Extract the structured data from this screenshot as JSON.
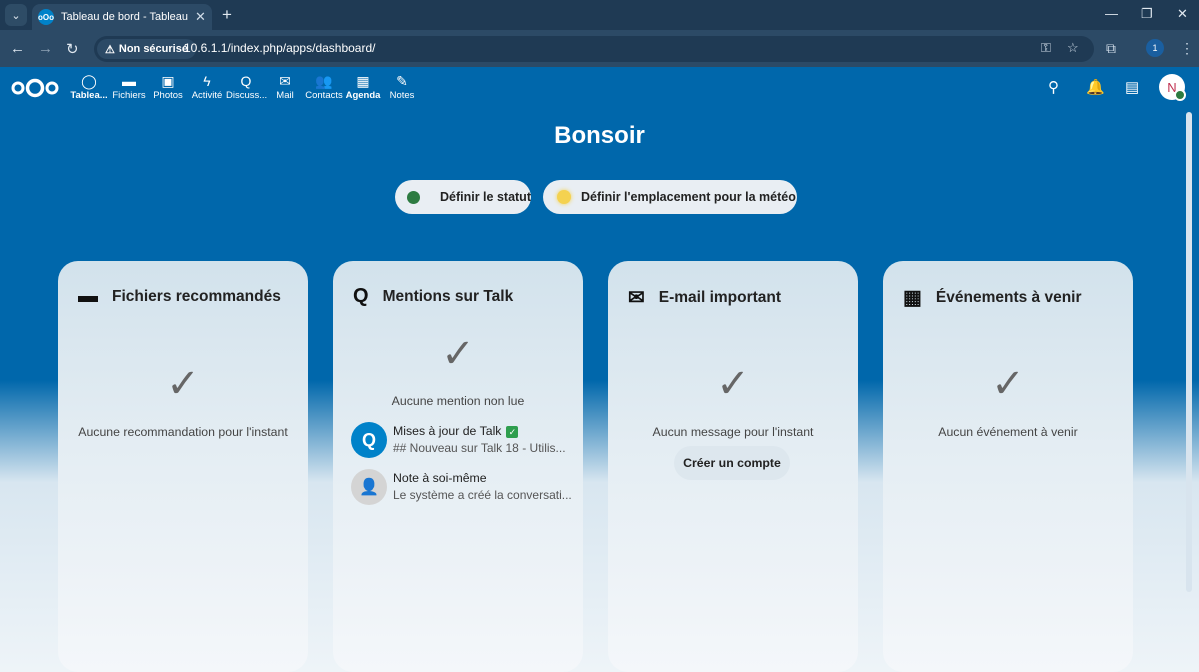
{
  "browser": {
    "tab_title": "Tableau de bord - Tableau de bord",
    "security_label": "Non sécurisé",
    "url": "10.6.1.1/index.php/apps/dashboard/",
    "profile_initial": "1"
  },
  "nav": {
    "apps": [
      {
        "label": "Tablea...",
        "icon": "dashboard-icon"
      },
      {
        "label": "Fichiers",
        "icon": "folder-icon"
      },
      {
        "label": "Photos",
        "icon": "image-icon"
      },
      {
        "label": "Activité",
        "icon": "lightning-icon"
      },
      {
        "label": "Discuss...",
        "icon": "talk-icon"
      },
      {
        "label": "Mail",
        "icon": "mail-icon"
      },
      {
        "label": "Contacts",
        "icon": "contacts-icon"
      },
      {
        "label": "Agenda",
        "icon": "calendar-icon"
      },
      {
        "label": "Notes",
        "icon": "pencil-icon"
      }
    ],
    "avatar_initial": "N"
  },
  "dashboard": {
    "greeting": "Bonsoir",
    "status_button": "Définir le statut",
    "weather_button": "Définir l'emplacement pour la météo"
  },
  "widgets": [
    {
      "title": "Fichiers recommandés",
      "empty": "Aucune recommandation pour l'instant"
    },
    {
      "title": "Mentions sur Talk",
      "empty": "Aucune mention non lue",
      "items": [
        {
          "title": "Mises à jour de Talk",
          "subtitle": "## Nouveau sur Talk 18 - Utilis..."
        },
        {
          "title": "Note à soi-même",
          "subtitle": "Le système a créé la conversati..."
        }
      ]
    },
    {
      "title": "E-mail important",
      "empty": "Aucun message pour l'instant",
      "action": "Créer un compte"
    },
    {
      "title": "Événements à venir",
      "empty": "Aucun événement à venir"
    }
  ]
}
